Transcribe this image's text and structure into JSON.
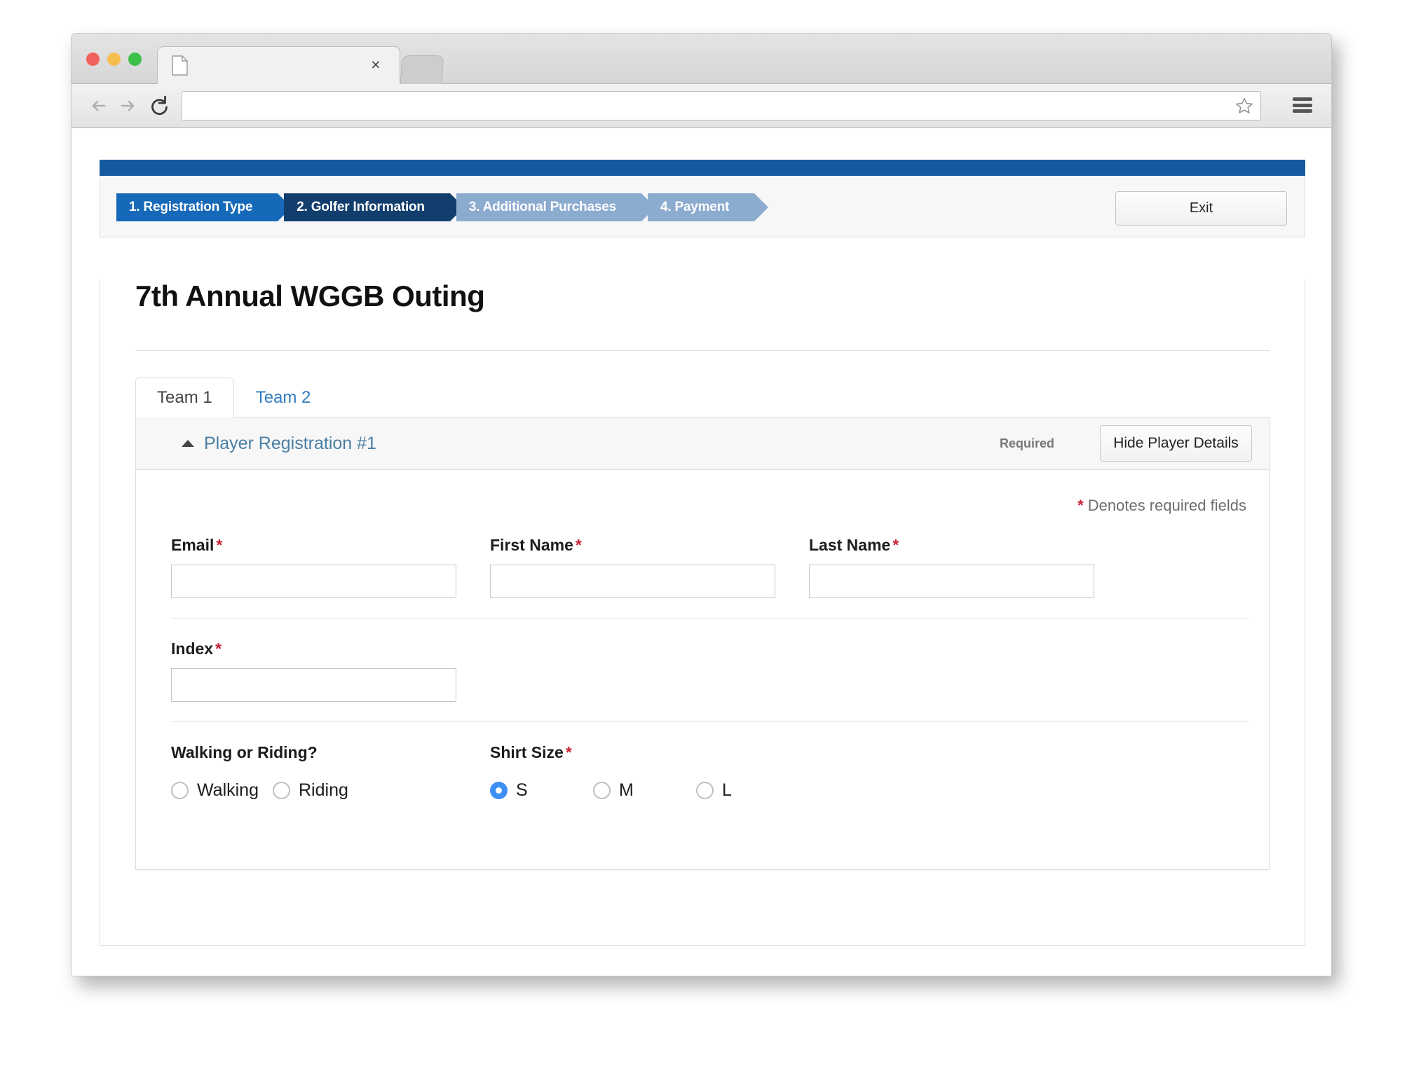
{
  "browser": {
    "tab_title": "",
    "tab_close_label": "×",
    "url_value": "",
    "url_placeholder": "",
    "traffic_lights": [
      "close",
      "minimize",
      "maximize"
    ],
    "icons": {
      "back": "back-arrow-icon",
      "forward": "forward-arrow-icon",
      "reload": "reload-icon",
      "bookmark": "star-icon",
      "menu": "hamburger-menu-icon",
      "tab_doc": "document-icon"
    }
  },
  "wizard": {
    "steps": [
      {
        "label": "1. Registration Type",
        "state": "done"
      },
      {
        "label": "2. Golfer Information",
        "state": "current"
      },
      {
        "label": "3. Additional Purchases",
        "state": "future"
      },
      {
        "label": "4. Payment",
        "state": "future"
      }
    ],
    "exit_label": "Exit"
  },
  "page": {
    "title": "7th Annual WGGB Outing"
  },
  "team_tabs": [
    {
      "label": "Team 1",
      "active": true
    },
    {
      "label": "Team 2",
      "active": false
    }
  ],
  "panel": {
    "title": "Player Registration #1",
    "required_tag": "Required",
    "hide_details_label": "Hide Player Details",
    "required_note_star": "*",
    "required_note_text": " Denotes required fields"
  },
  "form": {
    "fields": {
      "email": {
        "label": "Email",
        "required": true,
        "value": "",
        "placeholder": ""
      },
      "first_name": {
        "label": "First Name",
        "required": true,
        "value": "",
        "placeholder": ""
      },
      "last_name": {
        "label": "Last Name",
        "required": true,
        "value": "",
        "placeholder": ""
      },
      "index": {
        "label": "Index",
        "required": true,
        "value": "",
        "placeholder": ""
      }
    },
    "walking_or_riding": {
      "label": "Walking or Riding?",
      "required": false,
      "options": [
        {
          "label": "Walking",
          "checked": false
        },
        {
          "label": "Riding",
          "checked": false
        }
      ]
    },
    "shirt_size": {
      "label": "Shirt Size",
      "required": true,
      "options": [
        {
          "label": "S",
          "checked": true
        },
        {
          "label": "M",
          "checked": false
        },
        {
          "label": "L",
          "checked": false
        }
      ]
    },
    "required_marker": "*"
  },
  "colors": {
    "brand_blue": "#155a9e",
    "step_done": "#1669b8",
    "step_current": "#123e6e",
    "step_future": "#8babcf",
    "required_red": "#cc2236",
    "link_blue": "#2f7bbf",
    "radio_selected": "#3d8ef5"
  }
}
